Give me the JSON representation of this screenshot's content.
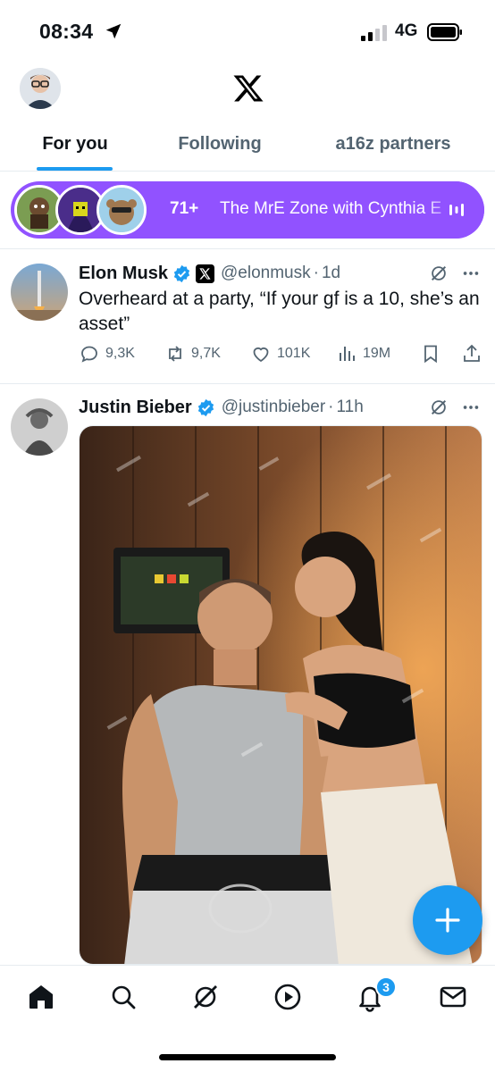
{
  "status_bar": {
    "time": "08:34",
    "network": "4G"
  },
  "header": {
    "logo": "X"
  },
  "tabs": [
    {
      "label": "For you",
      "active": true
    },
    {
      "label": "Following",
      "active": false
    },
    {
      "label": "a16z partners",
      "active": false
    }
  ],
  "space": {
    "count": "71+",
    "title": "The MrE Zone with Cynthia E"
  },
  "tweets": [
    {
      "author": "Elon Musk",
      "handle": "@elonmusk",
      "time": "1d",
      "text": "Overheard at a party, “If your gf is a 10, she’s an asset”",
      "stats": {
        "replies": "9,3K",
        "reposts": "9,7K",
        "likes": "101K",
        "views": "19M"
      }
    },
    {
      "author": "Justin Bieber",
      "handle": "@justinbieber",
      "time": "11h",
      "text": ""
    }
  ],
  "nav": {
    "notifications_badge": "3"
  },
  "colors": {
    "accent": "#1d9bf0",
    "spaces": "#9152ff",
    "secondary_text": "#536471"
  },
  "icons": [
    "location-arrow-icon",
    "signal-icon",
    "battery-icon",
    "x-logo-icon",
    "verified-icon",
    "grok-icon",
    "more-icon",
    "reply-icon",
    "repost-icon",
    "like-icon",
    "views-icon",
    "bookmark-icon",
    "share-icon",
    "home-icon",
    "search-icon",
    "grok-nav-icon",
    "video-icon",
    "bell-icon",
    "mail-icon",
    "compose-plus-icon"
  ]
}
